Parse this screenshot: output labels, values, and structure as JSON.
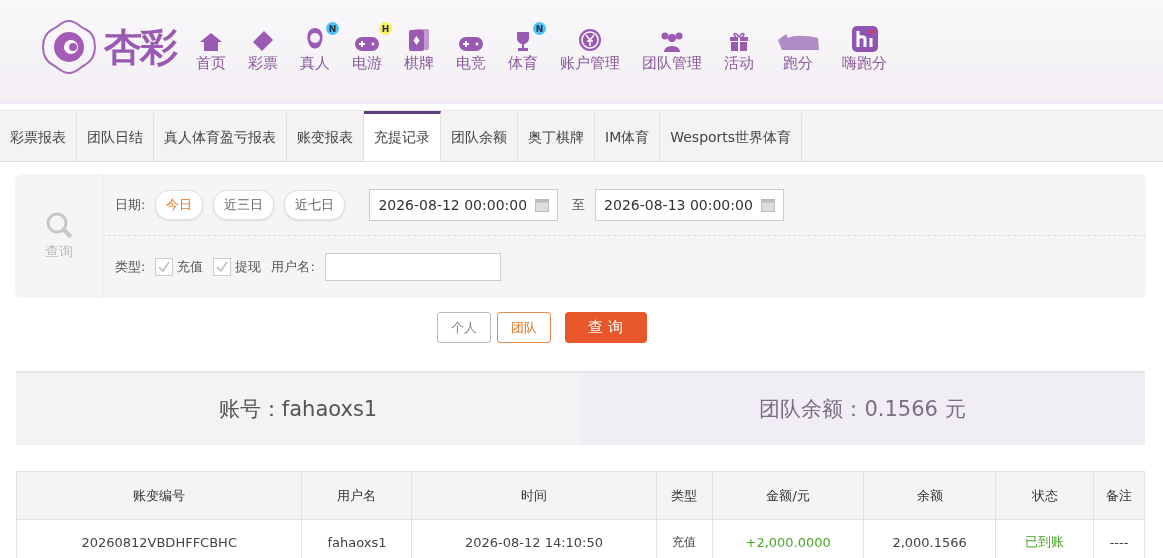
{
  "logo": {
    "text": "杏彩"
  },
  "nav": [
    {
      "label": "首页"
    },
    {
      "label": "彩票"
    },
    {
      "label": "真人",
      "badge": {
        "text": "N",
        "color": "#4fc3f7"
      }
    },
    {
      "label": "电游",
      "badge": {
        "text": "H",
        "color": "#f5f35a"
      }
    },
    {
      "label": "棋牌"
    },
    {
      "label": "电竞"
    },
    {
      "label": "体育",
      "badge": {
        "text": "N",
        "color": "#4fc3f7"
      }
    },
    {
      "label": "账户管理"
    },
    {
      "label": "团队管理"
    },
    {
      "label": "活动"
    },
    {
      "label": "跑分"
    },
    {
      "label": "嗨跑分"
    }
  ],
  "tabs": [
    {
      "label": "彩票报表",
      "selected": false
    },
    {
      "label": "团队日结",
      "selected": false
    },
    {
      "label": "真人体育盈亏报表",
      "selected": false
    },
    {
      "label": "账变报表",
      "selected": false
    },
    {
      "label": "充提记录",
      "selected": true
    },
    {
      "label": "团队余额",
      "selected": false
    },
    {
      "label": "奥丁棋牌",
      "selected": false
    },
    {
      "label": "IM体育",
      "selected": false
    },
    {
      "label": "Wesports世界体育",
      "selected": false
    }
  ],
  "filter": {
    "search_label": "查询",
    "date_label": "日期:",
    "ranges": [
      {
        "label": "今日",
        "selected": true
      },
      {
        "label": "近三日",
        "selected": false
      },
      {
        "label": "近七日",
        "selected": false
      }
    ],
    "start": "2026-08-12 00:00:00",
    "to": "至",
    "end": "2026-08-13 00:00:00",
    "type_label": "类型:",
    "types": [
      {
        "label": "充值",
        "checked": true
      },
      {
        "label": "提现",
        "checked": true
      }
    ],
    "username_label": "用户名:"
  },
  "scope": [
    {
      "label": "个人",
      "selected": false
    },
    {
      "label": "团队",
      "selected": true
    }
  ],
  "query_button": "查 询",
  "summary": {
    "account": "账号：fahaoxs1",
    "team_balance": "团队余额：0.1566 元"
  },
  "table": {
    "columns": [
      "账变编号",
      "用户名",
      "时间",
      "类型",
      "金额/元",
      "余额",
      "状态",
      "备注"
    ],
    "rows": [
      [
        "20260812VBDHFFCBHC",
        "fahaoxs1",
        "2026-08-12 14:10:50",
        "充值",
        "+2,000.0000",
        "2,000.1566",
        "已到账",
        "----"
      ]
    ]
  }
}
